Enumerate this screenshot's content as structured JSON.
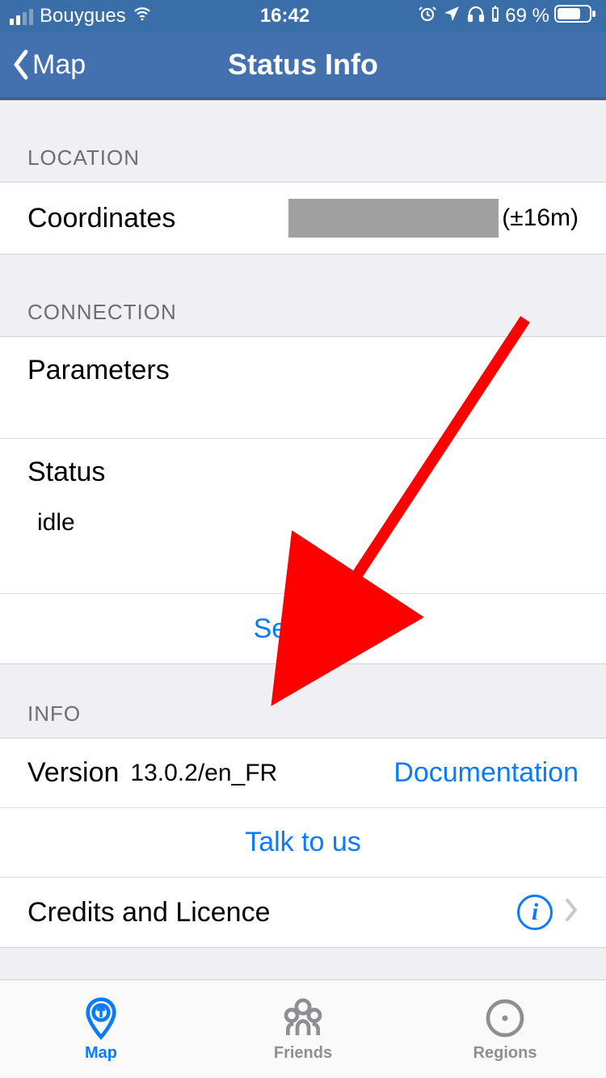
{
  "statusbar": {
    "carrier": "Bouygues",
    "time": "16:42",
    "battery_pct": "69 %"
  },
  "nav": {
    "back_label": "Map",
    "title": "Status Info"
  },
  "location": {
    "header": "LOCATION",
    "coordinates_label": "Coordinates",
    "accuracy": "(±16m)"
  },
  "connection": {
    "header": "CONNECTION",
    "parameters_label": "Parameters",
    "status_label": "Status",
    "status_value": "idle",
    "settings_label": "Settings"
  },
  "info": {
    "header": "INFO",
    "version_label": "Version",
    "version_value": "13.0.2/en_FR",
    "documentation_label": "Documentation",
    "talk_to_us_label": "Talk to us",
    "credits_label": "Credits and Licence"
  },
  "tabs": {
    "map": "Map",
    "friends": "Friends",
    "regions": "Regions"
  }
}
